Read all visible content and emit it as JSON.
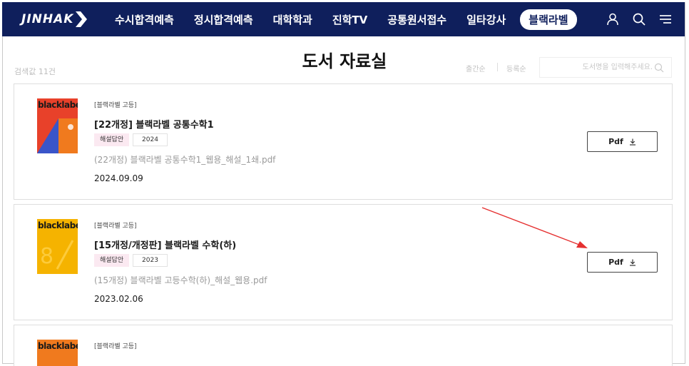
{
  "header": {
    "logo_text": "JINHAK",
    "nav": [
      "수시합격예측",
      "정시합격예측",
      "대학학과",
      "진학TV",
      "공통원서접수",
      "일타강사"
    ],
    "active_nav": "블랙라벨",
    "brand_color": "#0f1f5c"
  },
  "page": {
    "title": "도서 자료실",
    "result_count": "검색값 11건",
    "sort_options": [
      "출간순",
      "등록순"
    ],
    "search_placeholder": "도서명을 입력해주세요."
  },
  "books": [
    {
      "category": "[블랙라벨 고등]",
      "title": "[22개정] 블랙라벨 공통수학1",
      "badge_type": "해설답안",
      "badge_year": "2024",
      "file": "(22개정) 블랙라벨 공통수학1_웹용_해설_1쇄.pdf",
      "date": "2024.09.09",
      "button": "Pdf",
      "cover_brand": "blacklabel",
      "cover_color": "#e8412a"
    },
    {
      "category": "[블랙라벨 고등]",
      "title": "[15개정/개정판] 블랙라벨 수학(하)",
      "badge_type": "해설답안",
      "badge_year": "2023",
      "file": "(15개정) 블랙라벨 고등수학(하)_해설_웹용.pdf",
      "date": "2023.02.06",
      "button": "Pdf",
      "cover_brand": "blacklabel",
      "cover_color": "#f5b300"
    },
    {
      "category": "[블랙라벨 고등]",
      "cover_brand": "blacklabel",
      "cover_color": "#f07a1e"
    }
  ],
  "annotation_color": "#e53030"
}
